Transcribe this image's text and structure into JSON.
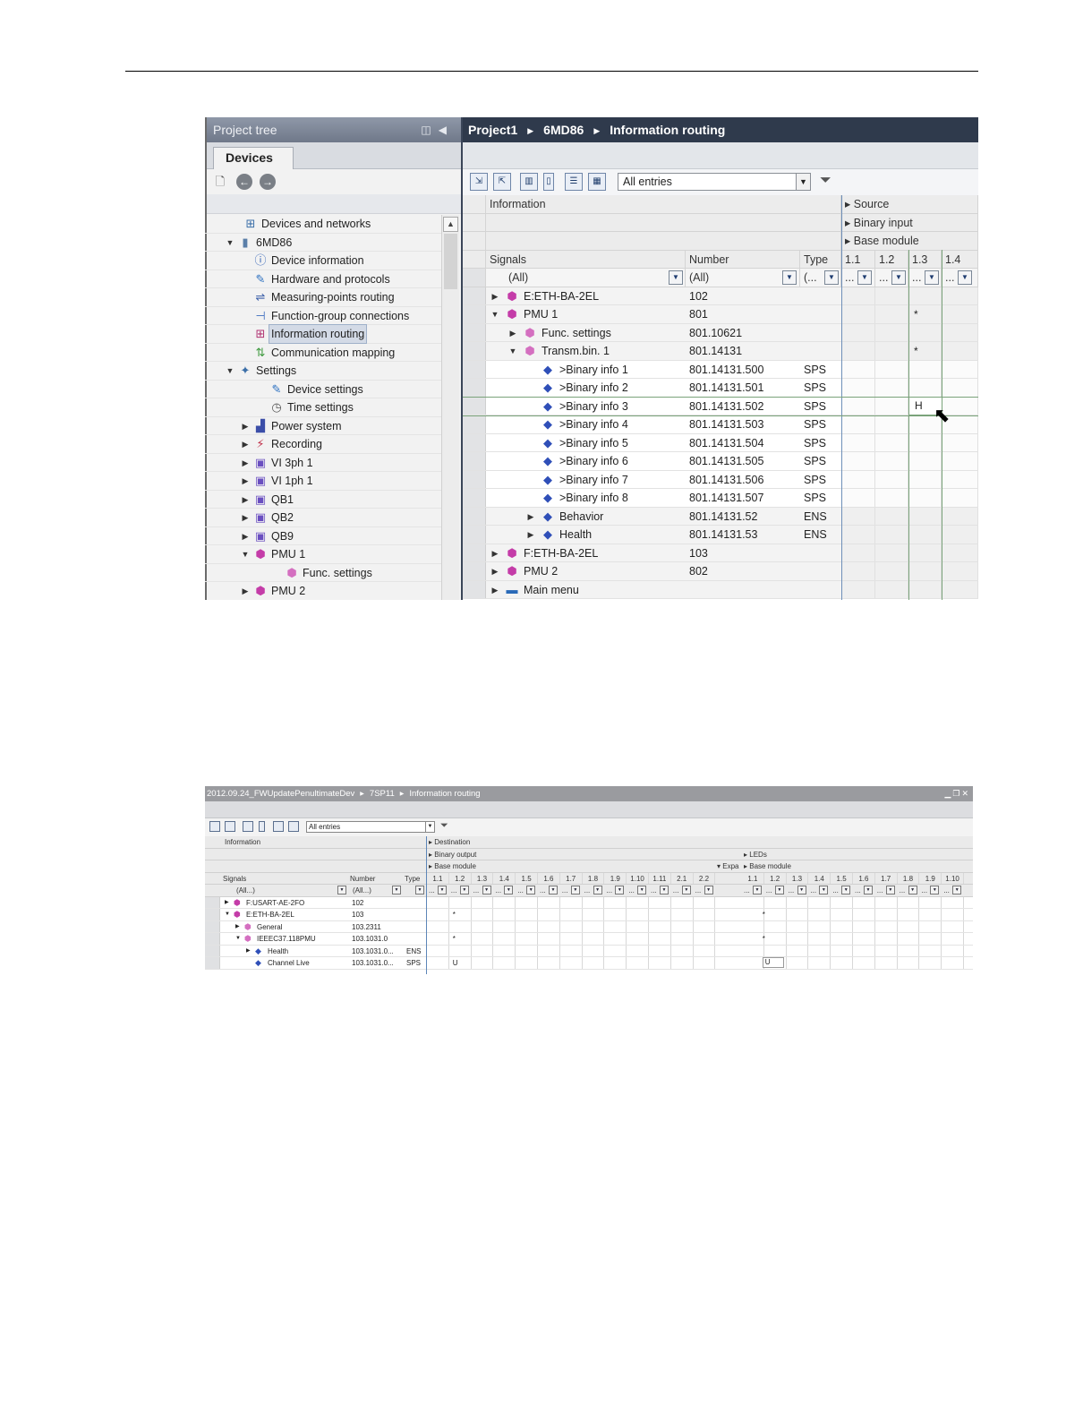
{
  "shot1": {
    "project_tree": {
      "title": "Project tree",
      "tab": "Devices",
      "items": [
        {
          "label": "Devices and networks",
          "icon": "network-icon",
          "arrow": ""
        },
        {
          "label": "6MD86",
          "icon": "device-icon",
          "arrow": "down"
        },
        {
          "label": "Device information",
          "icon": "info-icon",
          "arrow": ""
        },
        {
          "label": "Hardware and protocols",
          "icon": "pencil-icon",
          "arrow": ""
        },
        {
          "label": "Measuring-points routing",
          "icon": "routing-icon",
          "arrow": ""
        },
        {
          "label": "Function-group connections",
          "icon": "connection-icon",
          "arrow": ""
        },
        {
          "label": "Information routing",
          "icon": "grid-icon",
          "arrow": "",
          "selected": true
        },
        {
          "label": "Communication mapping",
          "icon": "comm-icon",
          "arrow": ""
        },
        {
          "label": "Settings",
          "icon": "settings-icon",
          "arrow": "down"
        },
        {
          "label": "Device settings",
          "icon": "pencil-icon",
          "arrow": ""
        },
        {
          "label": "Time settings",
          "icon": "clock-icon",
          "arrow": ""
        },
        {
          "label": "Power system",
          "icon": "chart-icon",
          "arrow": "right"
        },
        {
          "label": "Recording",
          "icon": "recording-icon",
          "arrow": "right"
        },
        {
          "label": "VI 3ph 1",
          "icon": "function-icon",
          "arrow": "right"
        },
        {
          "label": "VI 1ph 1",
          "icon": "function-icon",
          "arrow": "right"
        },
        {
          "label": "QB1",
          "icon": "function-icon",
          "arrow": "right"
        },
        {
          "label": "QB2",
          "icon": "function-icon",
          "arrow": "right"
        },
        {
          "label": "QB9",
          "icon": "function-icon",
          "arrow": "right"
        },
        {
          "label": "PMU 1",
          "icon": "cube-icon",
          "arrow": "down"
        },
        {
          "label": "Func. settings",
          "icon": "cube-small-icon",
          "arrow": ""
        },
        {
          "label": "PMU 2",
          "icon": "cube-icon",
          "arrow": "right"
        }
      ]
    },
    "routing": {
      "breadcrumb": [
        "Project1",
        "6MD86",
        "Information routing"
      ],
      "filter_value": "All entries",
      "header": {
        "information": "Information",
        "source": "Source",
        "binary_input": "Binary input",
        "base_module": "Base module",
        "signals": "Signals",
        "number": "Number",
        "type": "Type",
        "columns": [
          "1.1",
          "1.2",
          "1.3",
          "1.4"
        ],
        "filter_signals": "(All)",
        "filter_number": "(All)",
        "filter_type": "(...",
        "filter_col": "..."
      },
      "rows": [
        {
          "signal": "E:ETH-BA-2EL",
          "number": "102",
          "type": "",
          "arrow": "right",
          "icon": "cube-icon",
          "mark": ""
        },
        {
          "signal": "PMU 1",
          "number": "801",
          "type": "",
          "arrow": "down",
          "icon": "cube-icon",
          "mark": "*"
        },
        {
          "signal": "Func. settings",
          "number": "801.10621",
          "type": "",
          "arrow": "right",
          "icon": "cube-small-icon",
          "mark": ""
        },
        {
          "signal": "Transm.bin. 1",
          "number": "801.14131",
          "type": "",
          "arrow": "down",
          "icon": "cube-small-icon",
          "mark": "*"
        },
        {
          "signal": ">Binary info 1",
          "number": "801.14131.500",
          "type": "SPS",
          "arrow": "",
          "icon": "diamond-icon",
          "mark": ""
        },
        {
          "signal": ">Binary info 2",
          "number": "801.14131.501",
          "type": "SPS",
          "arrow": "",
          "icon": "diamond-icon",
          "mark": ""
        },
        {
          "signal": ">Binary info 3",
          "number": "801.14131.502",
          "type": "SPS",
          "arrow": "",
          "icon": "diamond-icon",
          "mark": "H"
        },
        {
          "signal": ">Binary info 4",
          "number": "801.14131.503",
          "type": "SPS",
          "arrow": "",
          "icon": "diamond-icon",
          "mark": ""
        },
        {
          "signal": ">Binary info 5",
          "number": "801.14131.504",
          "type": "SPS",
          "arrow": "",
          "icon": "diamond-icon",
          "mark": ""
        },
        {
          "signal": ">Binary info 6",
          "number": "801.14131.505",
          "type": "SPS",
          "arrow": "",
          "icon": "diamond-icon",
          "mark": ""
        },
        {
          "signal": ">Binary info 7",
          "number": "801.14131.506",
          "type": "SPS",
          "arrow": "",
          "icon": "diamond-icon",
          "mark": ""
        },
        {
          "signal": ">Binary info 8",
          "number": "801.14131.507",
          "type": "SPS",
          "arrow": "",
          "icon": "diamond-icon",
          "mark": ""
        },
        {
          "signal": "Behavior",
          "number": "801.14131.52",
          "type": "ENS",
          "arrow": "right",
          "icon": "diamond-icon",
          "mark": ""
        },
        {
          "signal": "Health",
          "number": "801.14131.53",
          "type": "ENS",
          "arrow": "right",
          "icon": "diamond-icon",
          "mark": ""
        },
        {
          "signal": "F:ETH-BA-2EL",
          "number": "103",
          "type": "",
          "arrow": "right",
          "icon": "cube-icon",
          "mark": ""
        },
        {
          "signal": "PMU 2",
          "number": "802",
          "type": "",
          "arrow": "right",
          "icon": "cube-icon",
          "mark": ""
        },
        {
          "signal": "Main menu",
          "number": "",
          "type": "",
          "arrow": "right",
          "icon": "menu-icon",
          "mark": ""
        }
      ]
    }
  },
  "shot2": {
    "breadcrumb": [
      "2012.09.24_FWUpdatePenultimateDev",
      "7SP11",
      "Information routing"
    ],
    "filter_value": "All entries",
    "header": {
      "information": "Information",
      "destination": "Destination",
      "binary_output": "Binary output",
      "leds": "LEDs",
      "base_module": "Base module",
      "expa": "Expa",
      "base_module_2": "Base module",
      "signals": "Signals",
      "number": "Number",
      "type": "Type",
      "columns_a": [
        "1.1",
        "1.2",
        "1.3",
        "1.4",
        "1.5",
        "1.6",
        "1.7",
        "1.8",
        "1.9",
        "1.10",
        "1.11",
        "2.1",
        "2.2"
      ],
      "columns_b": [
        "1.1",
        "1.2",
        "1.3",
        "1.4",
        "1.5",
        "1.6",
        "1.7",
        "1.8",
        "1.9",
        "1.10"
      ],
      "filter_signals": "(All...)",
      "filter_number": "(All...)",
      "filter_col": "..."
    },
    "rows": [
      {
        "signal": "F:USART-AE-2FO",
        "number": "102",
        "type": "",
        "mark_a": "",
        "mark_b": ""
      },
      {
        "signal": "E:ETH-BA-2EL",
        "number": "103",
        "type": "",
        "mark_a": "*",
        "mark_b": "*"
      },
      {
        "signal": "General",
        "number": "103.2311",
        "type": "",
        "mark_a": "",
        "mark_b": ""
      },
      {
        "signal": "IEEEC37.118PMU",
        "number": "103.1031.0",
        "type": "",
        "mark_a": "*",
        "mark_b": "*"
      },
      {
        "signal": "Health",
        "number": "103.1031.0...",
        "type": "ENS",
        "mark_a": "",
        "mark_b": ""
      },
      {
        "signal": "Channel Live",
        "number": "103.1031.0...",
        "type": "SPS",
        "mark_a": "U",
        "mark_b": "U"
      }
    ]
  }
}
